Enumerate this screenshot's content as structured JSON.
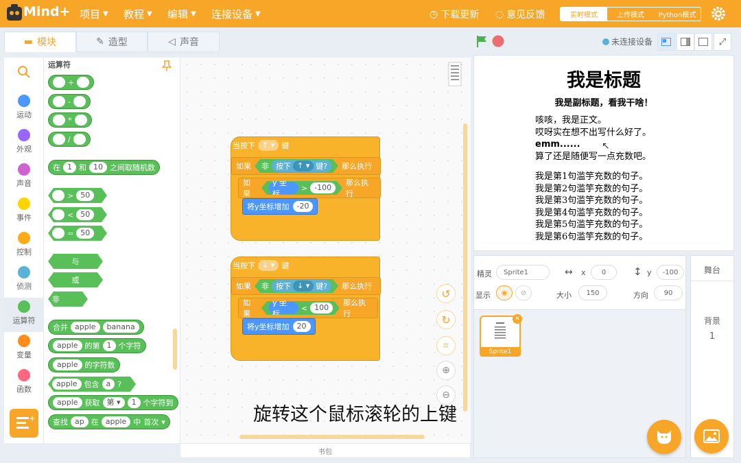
{
  "colors": {
    "accent": "#f8a628",
    "operator_green": "#59c059",
    "motion_blue": "#4c97ff",
    "sensing_blue": "#5cb1d6"
  },
  "topbar": {
    "logo_text": "Mind+",
    "menus": [
      "项目",
      "教程",
      "编辑",
      "连接设备"
    ],
    "update_label": "下载更新",
    "feedback_label": "意见反馈",
    "modes": [
      "实时模式",
      "上传模式",
      "Python模式"
    ],
    "active_mode": "实时模式"
  },
  "tabs": [
    {
      "label": "模块",
      "icon": "blocks-icon",
      "active": true
    },
    {
      "label": "造型",
      "icon": "brush-icon",
      "active": false
    },
    {
      "label": "声音",
      "icon": "speaker-icon",
      "active": false
    }
  ],
  "categories": [
    {
      "label": "运动",
      "color": "#4c97ff"
    },
    {
      "label": "外观",
      "color": "#9966ff"
    },
    {
      "label": "声音",
      "color": "#cf63cf"
    },
    {
      "label": "事件",
      "color": "#ffd500"
    },
    {
      "label": "控制",
      "color": "#ffab19"
    },
    {
      "label": "侦测",
      "color": "#5cb1d6"
    },
    {
      "label": "运算符",
      "color": "#59c059"
    },
    {
      "label": "变量",
      "color": "#ff8c1a"
    },
    {
      "label": "函数",
      "color": "#ff6680"
    }
  ],
  "palette": {
    "title": "运算符",
    "ops": [
      "+",
      "-",
      "*",
      "/"
    ],
    "random": {
      "a": "在",
      "from": "1",
      "and": "和",
      "to": "10",
      "b": "之间取随机数"
    },
    "compare": [
      {
        "op": ">",
        "v": "50"
      },
      {
        "op": "<",
        "v": "50"
      },
      {
        "op": "=",
        "v": "50"
      }
    ],
    "logic": [
      "与",
      "或",
      "非"
    ],
    "join": {
      "label": "合并",
      "a": "apple",
      "b": "banana"
    },
    "letter": {
      "a": "apple",
      "of": "的第",
      "n": "1",
      "unit": "个字符"
    },
    "length": {
      "a": "apple",
      "label": "的字符数"
    },
    "contains": {
      "a": "apple",
      "label": "包含",
      "b": "a",
      "q": "?"
    },
    "get": {
      "a": "apple",
      "label": "获取",
      "mode": "第",
      "n": "1",
      "unit": "个字符到"
    },
    "find": {
      "label": "查找",
      "a": "ap",
      "in": "在",
      "b": "apple",
      "mid": "中",
      "mode": "首次"
    }
  },
  "scripts": [
    {
      "hat": "当按下",
      "key": "↑",
      "hat_end": "键",
      "if": "如果",
      "not": "非",
      "pressed": "按下",
      "key2": "↑",
      "key_end": "键?",
      "then": "那么执行",
      "inner_if": "如果",
      "var": "y 坐标",
      "op": ">",
      "val": "-100",
      "inner_then": "那么执行",
      "action": "将y坐标增加",
      "delta": "-20"
    },
    {
      "hat": "当按下",
      "key": "↓",
      "hat_end": "键",
      "if": "如果",
      "not": "非",
      "pressed": "按下",
      "key2": "↓",
      "key_end": "键?",
      "then": "那么执行",
      "inner_if": "如果",
      "var": "y 坐标",
      "op": "<",
      "val": "100",
      "inner_then": "那么执行",
      "action": "将y坐标增加",
      "delta": "20"
    }
  ],
  "subtitle": "旋转这个鼠标滚轮的上键",
  "bookbag": "书包",
  "stage_header": {
    "connection": "未连接设备"
  },
  "stage": {
    "title": "我是标题",
    "subtitle": "我是副标题，看我干啥！",
    "lines": [
      "咳咳，我是正文。",
      "哎呀实在想不出写什么好了。",
      "emm......",
      "算了还是随便写一点充数吧。",
      "",
      "我是第1句滥竽充数的句子。",
      "我是第2句滥竽充数的句子。",
      "我是第3句滥竽充数的句子。",
      "我是第4句滥竽充数的句子。",
      "我是第5句滥竽充数的句子。",
      "我是第6句滥竽充数的句子。"
    ]
  },
  "sprite": {
    "label": "精灵",
    "name": "Sprite1",
    "x_label": "x",
    "x": "0",
    "y_label": "y",
    "y": "-100",
    "show_label": "显示",
    "size_label": "大小",
    "size": "150",
    "dir_label": "方向",
    "dir": "90",
    "thumb_name": "Sprite1"
  },
  "stage_pane": {
    "title": "舞台",
    "bg_label": "背景",
    "bg_count": "1"
  }
}
